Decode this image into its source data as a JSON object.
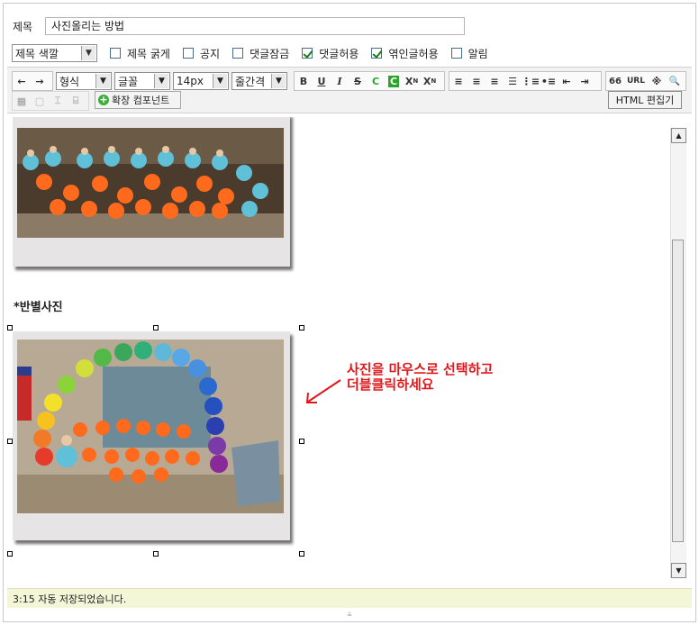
{
  "form": {
    "title_label": "제목",
    "title_value": "사진올리는 방법"
  },
  "options": {
    "color_select": "제목 색깔",
    "checkboxes": [
      {
        "label": "제목 굵게",
        "checked": false
      },
      {
        "label": "공지",
        "checked": false
      },
      {
        "label": "댓글잠금",
        "checked": false
      },
      {
        "label": "댓글허용",
        "checked": true
      },
      {
        "label": "엮인글허용",
        "checked": true
      },
      {
        "label": "알림",
        "checked": false
      }
    ]
  },
  "toolbar": {
    "undo": "←",
    "redo": "→",
    "format": "형식",
    "font": "글꼴",
    "size": "14px",
    "line_height": "줄간격",
    "bold": "B",
    "underline": "U",
    "italic": "I",
    "strike": "S",
    "fg_color": "C",
    "bg_color": "C",
    "sup": "X",
    "sub": "X",
    "quote": "66",
    "url": "URL",
    "special": "※",
    "find": "🔍",
    "ext_components": "확장 컴포넌트",
    "html_editor": "HTML 편집기"
  },
  "content": {
    "section_heading": "*반별사진",
    "annotation_line1": "사진을 마우스로 선택하고",
    "annotation_line2": "더블클릭하세요",
    "annotation_color": "#e0191d"
  },
  "status": {
    "message": "3:15 자동 저장되었습니다."
  }
}
